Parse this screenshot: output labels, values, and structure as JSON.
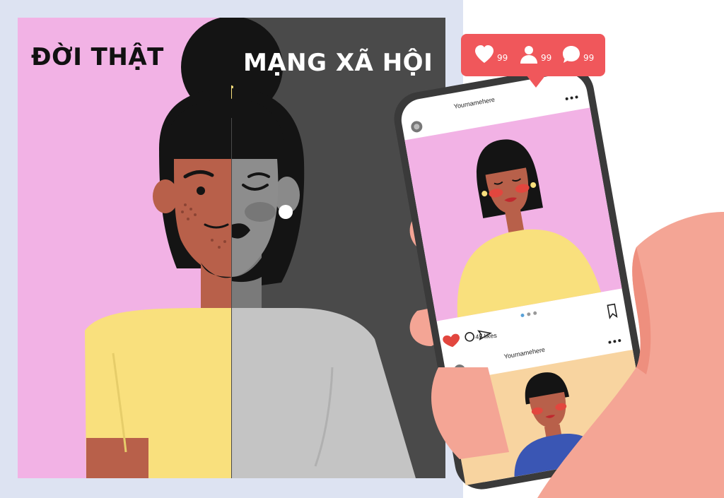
{
  "captions": {
    "real_life": "ĐỜI THẬT",
    "social_media": "MẠNG XÃ HỘI"
  },
  "notification": {
    "likes": "99",
    "followers": "99",
    "comments": "99",
    "icons": [
      "heart-icon",
      "person-icon",
      "comment-bubble-icon"
    ]
  },
  "feed": {
    "post1": {
      "username": "Yournamehere",
      "likes": "45 likes"
    },
    "post2": {
      "username": "Yournamehere"
    },
    "actions": [
      "heart-icon",
      "comment-icon",
      "share-icon",
      "bookmark-icon"
    ]
  },
  "colors": {
    "real_bg": "#f2b2e5",
    "social_bg": "#4a4a4a",
    "skin": "#b8604a",
    "shirt": "#f9e07d",
    "notification": "#f0575b",
    "hand": "#f4a595"
  }
}
